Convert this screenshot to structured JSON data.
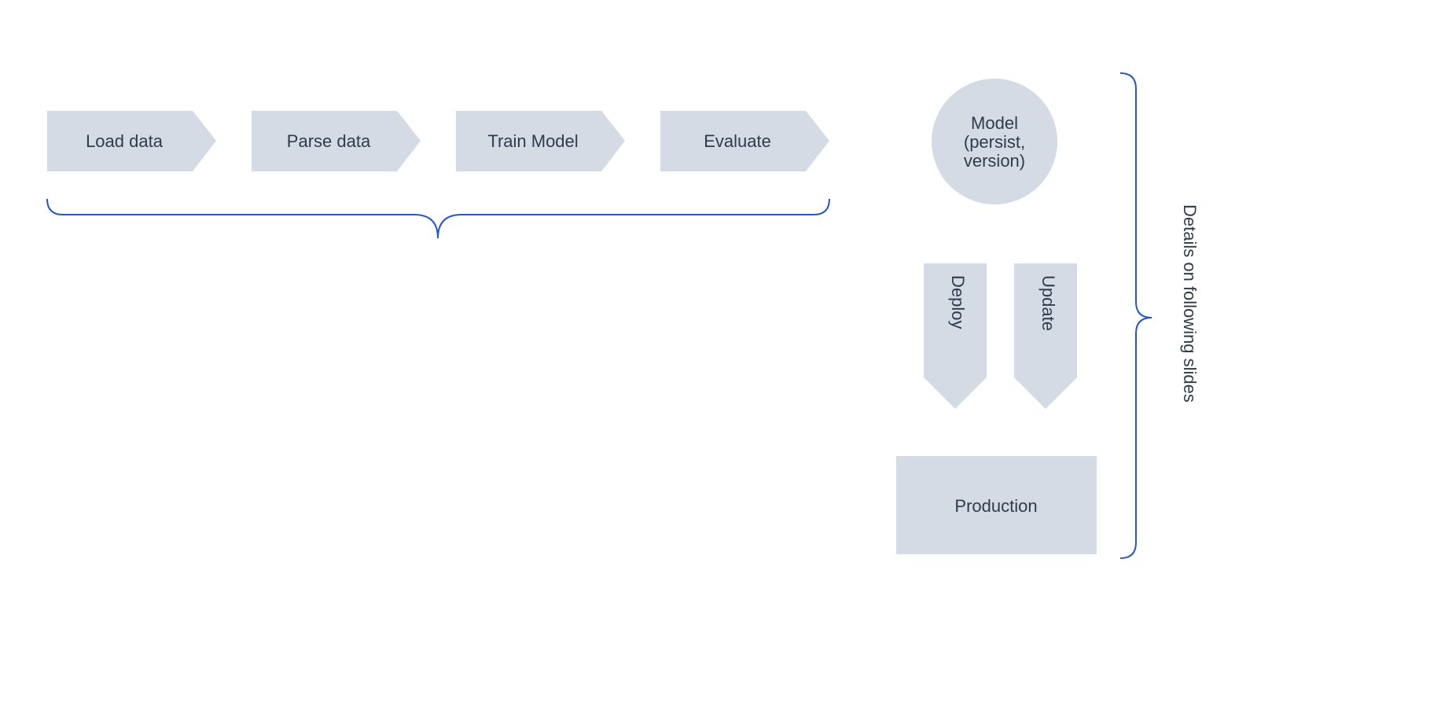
{
  "pipeline": {
    "steps": [
      "Load data",
      "Parse data",
      "Train Model",
      "Evaluate"
    ]
  },
  "model_node": {
    "line1": "Model",
    "line2": "(persist,",
    "line3": "version)"
  },
  "arrows": {
    "deploy": "Deploy",
    "update": "Update"
  },
  "production_label": "Production",
  "side_note": "Details on following slides",
  "colors": {
    "shape_fill": "#d4dbe4",
    "shape_stroke": "#d4dbe4",
    "brace_stroke": "#2358c3",
    "text": "#2f3b4c"
  }
}
